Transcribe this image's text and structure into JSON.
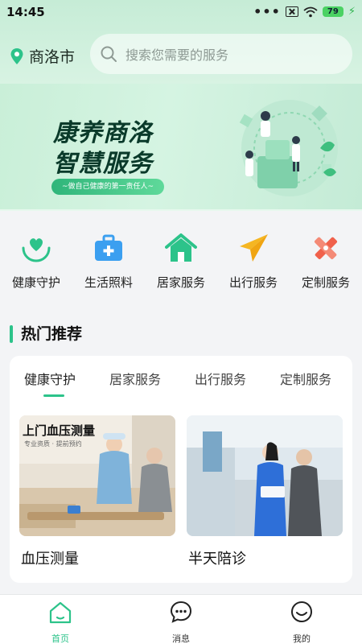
{
  "status_bar": {
    "time": "14:45",
    "battery": "79"
  },
  "header": {
    "location": "商洛市",
    "search_placeholder": "搜索您需要的服务"
  },
  "banner": {
    "title_line1": "康养商洛",
    "title_line2": "智慧服务",
    "subtitle": "~做自己健康的第一责任人~"
  },
  "categories": [
    {
      "label": "健康守护",
      "icon": "heart-hands-icon",
      "color": "#2cc38a"
    },
    {
      "label": "生活照料",
      "icon": "medical-kit-icon",
      "color": "#3b9ff0"
    },
    {
      "label": "居家服务",
      "icon": "home-icon",
      "color": "#2cc38a"
    },
    {
      "label": "出行服务",
      "icon": "paper-plane-icon",
      "color": "#f5b622"
    },
    {
      "label": "定制服务",
      "icon": "tools-icon",
      "color": "#f0614b"
    }
  ],
  "section": {
    "title": "热门推荐"
  },
  "tabs": [
    "健康守护",
    "居家服务",
    "出行服务",
    "定制服务"
  ],
  "tiles": [
    {
      "label": "血压测量",
      "overlay_title": "上门血压测量",
      "overlay_sub": "专业资质 · 提前预约"
    },
    {
      "label": "半天陪诊"
    }
  ],
  "nav": [
    {
      "label": "首页",
      "icon": "home-outline-icon",
      "active": true
    },
    {
      "label": "消息",
      "icon": "chat-bubble-icon",
      "active": false
    },
    {
      "label": "我的",
      "icon": "smiley-icon",
      "active": false
    }
  ],
  "colors": {
    "accent": "#2cc38a",
    "background": "#f3f4f6"
  }
}
